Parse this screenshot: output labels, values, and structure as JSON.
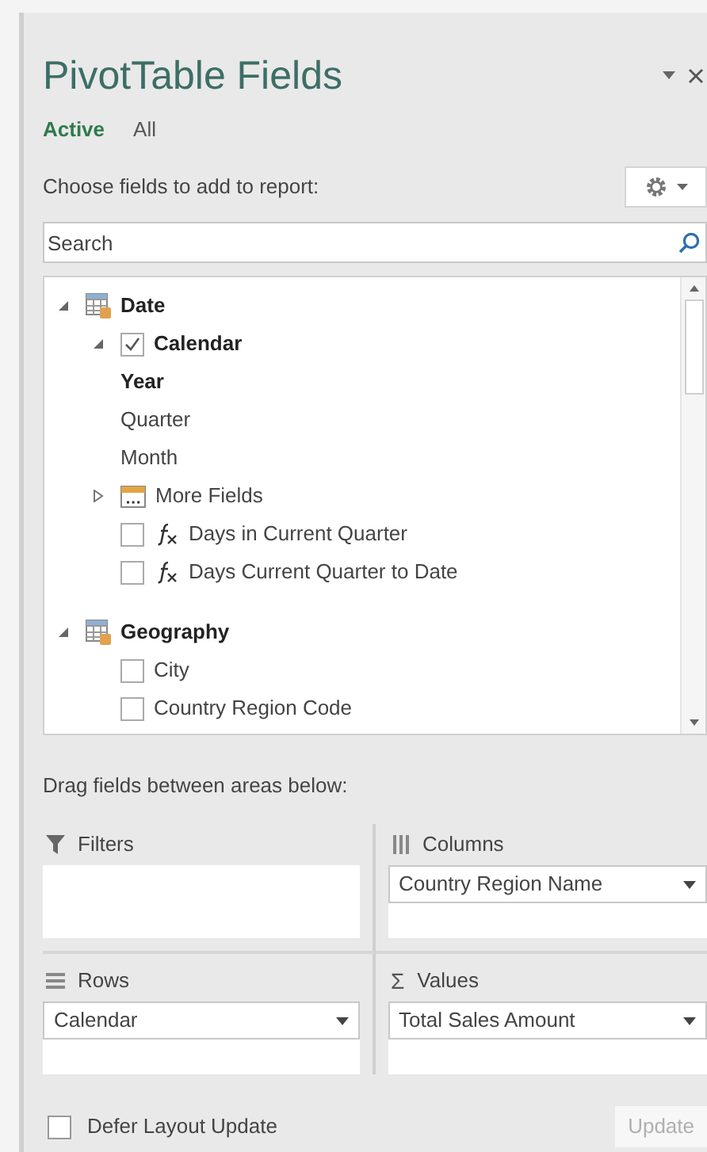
{
  "title": "PivotTable Fields",
  "tabs": [
    {
      "label": "Active",
      "selected": true
    },
    {
      "label": "All",
      "selected": false
    }
  ],
  "choose_label": "Choose fields to add to report:",
  "search": {
    "placeholder": "Search"
  },
  "fields": [
    {
      "kind": "table",
      "label": "Date",
      "expanded": true,
      "children": [
        {
          "kind": "hierarchy",
          "label": "Calendar",
          "expanded": true,
          "checked": true,
          "children": [
            {
              "kind": "level",
              "label": "Year",
              "used": true
            },
            {
              "kind": "level",
              "label": "Quarter",
              "used": false
            },
            {
              "kind": "level",
              "label": "Month",
              "used": false
            }
          ]
        },
        {
          "kind": "folder",
          "label": "More Fields",
          "expanded": false
        },
        {
          "kind": "measure",
          "label": "Days in Current Quarter",
          "checked": false
        },
        {
          "kind": "measure",
          "label": "Days Current Quarter to Date",
          "checked": false
        }
      ]
    },
    {
      "kind": "table",
      "label": "Geography",
      "expanded": true,
      "children": [
        {
          "kind": "field",
          "label": "City",
          "checked": false
        },
        {
          "kind": "field",
          "label": "Country Region Code",
          "checked": false
        }
      ]
    }
  ],
  "drag_label": "Drag fields between areas below:",
  "areas": [
    {
      "kind": "filters",
      "label": "Filters"
    },
    {
      "kind": "columns",
      "label": "Columns",
      "items": [
        "Country Region Name"
      ]
    },
    {
      "kind": "rows",
      "label": "Rows",
      "items": [
        "Calendar"
      ]
    },
    {
      "kind": "values",
      "label": "Values",
      "symbol": "Σ",
      "items": [
        "Total Sales Amount"
      ]
    }
  ],
  "defer": {
    "label": "Defer Layout Update",
    "checked": false
  },
  "update_button": {
    "label": "Update",
    "disabled": true
  }
}
